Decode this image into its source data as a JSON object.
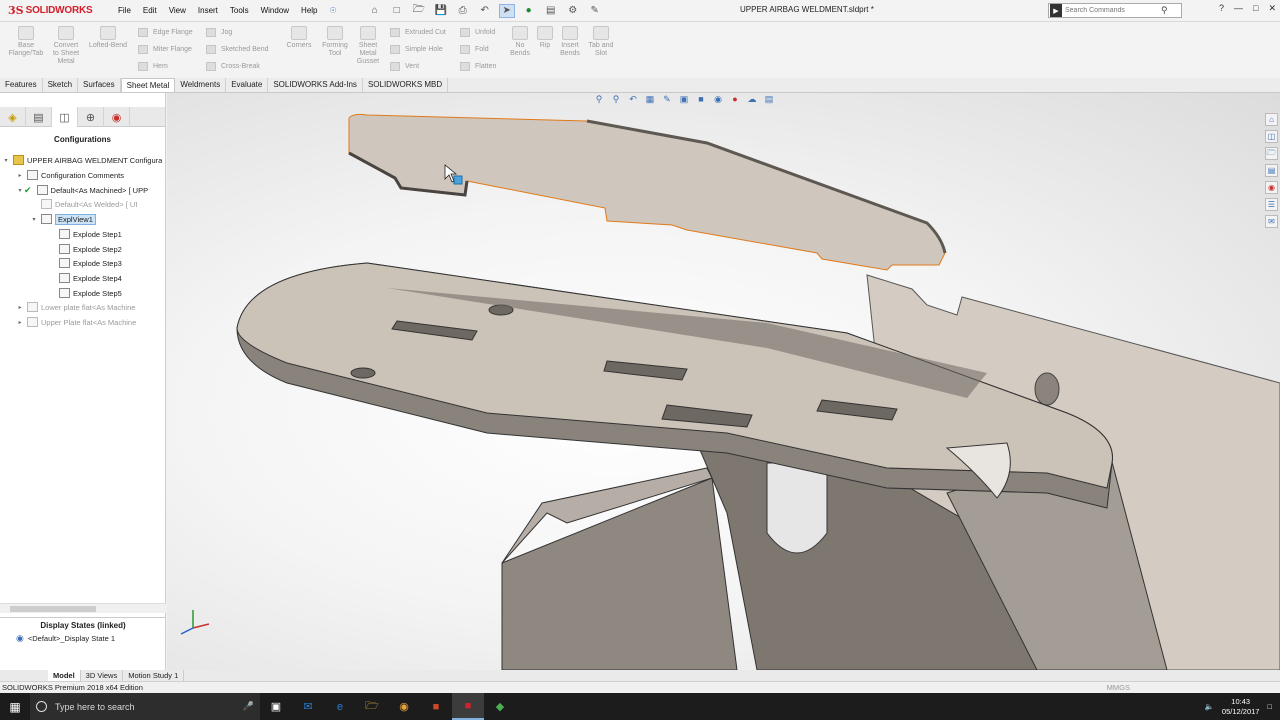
{
  "app": {
    "logo_text": "SOLIDWORKS",
    "logo_mark": "3S",
    "document_title": "UPPER AIRBAG WELDMENT.sldprt *",
    "menus": [
      "File",
      "Edit",
      "View",
      "Insert",
      "Tools",
      "Window",
      "Help"
    ],
    "search_placeholder": "Search Commands",
    "help_symbol": "?"
  },
  "ribbon": {
    "big_buttons": [
      {
        "label": "Base\nFlange/Tab"
      },
      {
        "label": "Convert\nto Sheet\nMetal"
      },
      {
        "label": "Lofted-Bend"
      },
      {
        "label": "Corners"
      },
      {
        "label": "Forming\nTool"
      },
      {
        "label": "Sheet\nMetal\nGusset"
      },
      {
        "label": "No\nBends"
      },
      {
        "label": "Rip"
      },
      {
        "label": "Insert\nBends"
      },
      {
        "label": "Tab and\nSlot"
      }
    ],
    "small_buttons": {
      "col1": [
        "Edge Flange",
        "Miter Flange",
        "Hem"
      ],
      "col2": [
        "Jog",
        "Sketched Bend",
        "Cross-Break"
      ],
      "col3": [
        "Extruded Cut",
        "Simple Hole",
        "Vent"
      ],
      "col4": [
        "Unfold",
        "Fold",
        "Flatten"
      ]
    }
  },
  "cmd_tabs": [
    "Features",
    "Sketch",
    "Surfaces",
    "Sheet Metal",
    "Weldments",
    "Evaluate",
    "SOLIDWORKS Add-Ins",
    "SOLIDWORKS MBD"
  ],
  "active_cmd_tab": "Sheet Metal",
  "config_panel": {
    "heading": "Configurations",
    "tree": [
      {
        "label": "UPPER AIRBAG WELDMENT Configura",
        "level": 0,
        "dim": false
      },
      {
        "label": "Configuration Comments",
        "level": 1,
        "dim": false
      },
      {
        "label": "Default<As Machined> [ UPP",
        "level": 1,
        "dim": false
      },
      {
        "label": "Default<As Welded> [ UI",
        "level": 2,
        "dim": true
      },
      {
        "label": "ExplView1",
        "level": 1,
        "dim": false,
        "selected": true
      },
      {
        "label": "Explode Step1",
        "level": 2,
        "dim": false
      },
      {
        "label": "Explode Step2",
        "level": 2,
        "dim": false
      },
      {
        "label": "Explode Step3",
        "level": 2,
        "dim": false
      },
      {
        "label": "Explode Step4",
        "level": 2,
        "dim": false
      },
      {
        "label": "Explode Step5",
        "level": 2,
        "dim": false
      },
      {
        "label": "Lower plate flat<As Machine",
        "level": 1,
        "dim": true
      },
      {
        "label": "Upper Plate flat<As Machine",
        "level": 1,
        "dim": true
      }
    ],
    "display_states_heading": "Display States (linked)",
    "display_state": "<Default>_Display State 1"
  },
  "bottom_tabs": [
    "Model",
    "3D Views",
    "Motion Study 1"
  ],
  "active_bottom_tab": "Model",
  "status": {
    "edition": "SOLIDWORKS Premium 2018 x64 Edition",
    "units": "MMGS"
  },
  "taskbar": {
    "search_placeholder": "Type here to search",
    "time": "10:43",
    "date": "05/12/2017"
  },
  "colors": {
    "accent_red": "#d4202c",
    "selection_blue": "#cce4f7",
    "part_fill": "#cfc6bd",
    "part_edge": "#e07a1a"
  }
}
